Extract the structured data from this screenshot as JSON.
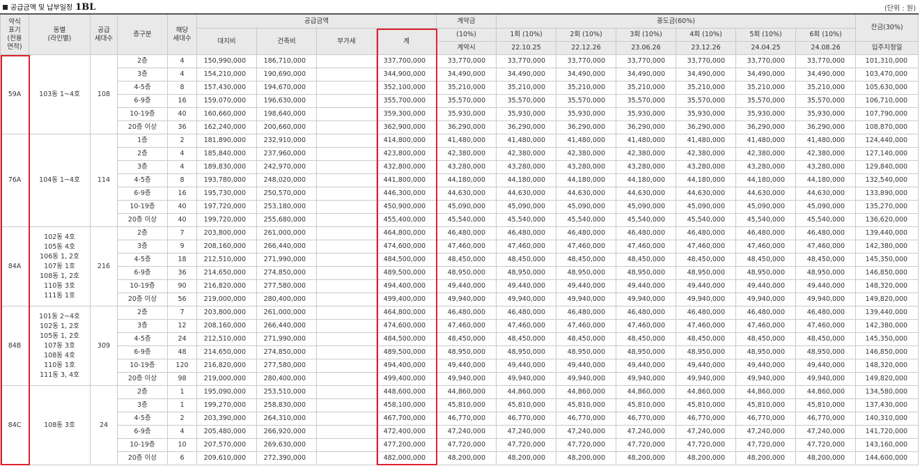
{
  "title": "공급금액 및 납부일정",
  "block": "1BL",
  "unit": "(단위 : 원)",
  "headers": {
    "type": "약식\n표기\n(전용\n면적)",
    "dong": "동별\n(라인별)",
    "supply_units": "공급\n세대수",
    "floor": "층구분",
    "units": "해당\n세대수",
    "supply_price": "공급금액",
    "land": "대지비",
    "building": "건축비",
    "vat": "부가세",
    "total": "계",
    "deposit": "계약금",
    "deposit_pct": "(10%)",
    "deposit_when": "계약시",
    "middle": "중도금(60%)",
    "middle_installments": [
      {
        "label": "1회 (10%)",
        "date": "22.10.25"
      },
      {
        "label": "2회 (10%)",
        "date": "22.12.26"
      },
      {
        "label": "3회 (10%)",
        "date": "23.06.26"
      },
      {
        "label": "4회 (10%)",
        "date": "23.12.26"
      },
      {
        "label": "5회 (10%)",
        "date": "24.04.25"
      },
      {
        "label": "6회 (10%)",
        "date": "24.08.26"
      }
    ],
    "balance": "잔금(30%)",
    "balance_when": "입주지정일"
  },
  "groups": [
    {
      "type": "59A",
      "dong": "103동 1~4호",
      "supply_units": "108",
      "rows": [
        {
          "floor": "2층",
          "units": "4",
          "land": "150,990,000",
          "building": "186,710,000",
          "vat": "",
          "total": "337,700,000",
          "deposit": "33,770,000",
          "middle": "33,770,000",
          "balance": "101,310,000"
        },
        {
          "floor": "3층",
          "units": "4",
          "land": "154,210,000",
          "building": "190,690,000",
          "vat": "",
          "total": "344,900,000",
          "deposit": "34,490,000",
          "middle": "34,490,000",
          "balance": "103,470,000"
        },
        {
          "floor": "4-5층",
          "units": "8",
          "land": "157,430,000",
          "building": "194,670,000",
          "vat": "",
          "total": "352,100,000",
          "deposit": "35,210,000",
          "middle": "35,210,000",
          "balance": "105,630,000"
        },
        {
          "floor": "6-9층",
          "units": "16",
          "land": "159,070,000",
          "building": "196,630,000",
          "vat": "",
          "total": "355,700,000",
          "deposit": "35,570,000",
          "middle": "35,570,000",
          "balance": "106,710,000"
        },
        {
          "floor": "10-19층",
          "units": "40",
          "land": "160,660,000",
          "building": "198,640,000",
          "vat": "",
          "total": "359,300,000",
          "deposit": "35,930,000",
          "middle": "35,930,000",
          "balance": "107,790,000"
        },
        {
          "floor": "20층 이상",
          "units": "36",
          "land": "162,240,000",
          "building": "200,660,000",
          "vat": "",
          "total": "362,900,000",
          "deposit": "36,290,000",
          "middle": "36,290,000",
          "balance": "108,870,000"
        }
      ]
    },
    {
      "type": "76A",
      "dong": "104동 1~4호",
      "supply_units": "114",
      "rows": [
        {
          "floor": "1층",
          "units": "2",
          "land": "181,890,000",
          "building": "232,910,000",
          "vat": "",
          "total": "414,800,000",
          "deposit": "41,480,000",
          "middle": "41,480,000",
          "balance": "124,440,000"
        },
        {
          "floor": "2층",
          "units": "4",
          "land": "185,840,000",
          "building": "237,960,000",
          "vat": "",
          "total": "423,800,000",
          "deposit": "42,380,000",
          "middle": "42,380,000",
          "balance": "127,140,000"
        },
        {
          "floor": "3층",
          "units": "4",
          "land": "189,830,000",
          "building": "242,970,000",
          "vat": "",
          "total": "432,800,000",
          "deposit": "43,280,000",
          "middle": "43,280,000",
          "balance": "129,840,000"
        },
        {
          "floor": "4-5층",
          "units": "8",
          "land": "193,780,000",
          "building": "248,020,000",
          "vat": "",
          "total": "441,800,000",
          "deposit": "44,180,000",
          "middle": "44,180,000",
          "balance": "132,540,000"
        },
        {
          "floor": "6-9층",
          "units": "16",
          "land": "195,730,000",
          "building": "250,570,000",
          "vat": "",
          "total": "446,300,000",
          "deposit": "44,630,000",
          "middle": "44,630,000",
          "balance": "133,890,000"
        },
        {
          "floor": "10-19층",
          "units": "40",
          "land": "197,720,000",
          "building": "253,180,000",
          "vat": "",
          "total": "450,900,000",
          "deposit": "45,090,000",
          "middle": "45,090,000",
          "balance": "135,270,000"
        },
        {
          "floor": "20층 이상",
          "units": "40",
          "land": "199,720,000",
          "building": "255,680,000",
          "vat": "",
          "total": "455,400,000",
          "deposit": "45,540,000",
          "middle": "45,540,000",
          "balance": "136,620,000"
        }
      ]
    },
    {
      "type": "84A",
      "dong": "102동 4호\n105동 4호\n106동 1, 2호\n107동 1호\n108동 1, 2호\n110동 3호\n111동 1호",
      "supply_units": "216",
      "rows": [
        {
          "floor": "2층",
          "units": "7",
          "land": "203,800,000",
          "building": "261,000,000",
          "vat": "",
          "total": "464,800,000",
          "deposit": "46,480,000",
          "middle": "46,480,000",
          "balance": "139,440,000"
        },
        {
          "floor": "3층",
          "units": "9",
          "land": "208,160,000",
          "building": "266,440,000",
          "vat": "",
          "total": "474,600,000",
          "deposit": "47,460,000",
          "middle": "47,460,000",
          "balance": "142,380,000"
        },
        {
          "floor": "4-5층",
          "units": "18",
          "land": "212,510,000",
          "building": "271,990,000",
          "vat": "",
          "total": "484,500,000",
          "deposit": "48,450,000",
          "middle": "48,450,000",
          "balance": "145,350,000"
        },
        {
          "floor": "6-9층",
          "units": "36",
          "land": "214,650,000",
          "building": "274,850,000",
          "vat": "",
          "total": "489,500,000",
          "deposit": "48,950,000",
          "middle": "48,950,000",
          "balance": "146,850,000"
        },
        {
          "floor": "10-19층",
          "units": "90",
          "land": "216,820,000",
          "building": "277,580,000",
          "vat": "",
          "total": "494,400,000",
          "deposit": "49,440,000",
          "middle": "49,440,000",
          "balance": "148,320,000"
        },
        {
          "floor": "20층 이상",
          "units": "56",
          "land": "219,000,000",
          "building": "280,400,000",
          "vat": "",
          "total": "499,400,000",
          "deposit": "49,940,000",
          "middle": "49,940,000",
          "balance": "149,820,000"
        }
      ]
    },
    {
      "type": "84B",
      "dong": "101동 2~4호\n102동 1, 2호\n105동 1, 2호\n107동 3호\n108동 4호\n110동 1호\n111동 3, 4호",
      "supply_units": "309",
      "rows": [
        {
          "floor": "2층",
          "units": "7",
          "land": "203,800,000",
          "building": "261,000,000",
          "vat": "",
          "total": "464,800,000",
          "deposit": "46,480,000",
          "middle": "46,480,000",
          "balance": "139,440,000"
        },
        {
          "floor": "3층",
          "units": "12",
          "land": "208,160,000",
          "building": "266,440,000",
          "vat": "",
          "total": "474,600,000",
          "deposit": "47,460,000",
          "middle": "47,460,000",
          "balance": "142,380,000"
        },
        {
          "floor": "4-5층",
          "units": "24",
          "land": "212,510,000",
          "building": "271,990,000",
          "vat": "",
          "total": "484,500,000",
          "deposit": "48,450,000",
          "middle": "48,450,000",
          "balance": "145,350,000"
        },
        {
          "floor": "6-9층",
          "units": "48",
          "land": "214,650,000",
          "building": "274,850,000",
          "vat": "",
          "total": "489,500,000",
          "deposit": "48,950,000",
          "middle": "48,950,000",
          "balance": "146,850,000"
        },
        {
          "floor": "10-19층",
          "units": "120",
          "land": "216,820,000",
          "building": "277,580,000",
          "vat": "",
          "total": "494,400,000",
          "deposit": "49,440,000",
          "middle": "49,440,000",
          "balance": "148,320,000"
        },
        {
          "floor": "20층 이상",
          "units": "98",
          "land": "219,000,000",
          "building": "280,400,000",
          "vat": "",
          "total": "499,400,000",
          "deposit": "49,940,000",
          "middle": "49,940,000",
          "balance": "149,820,000"
        }
      ]
    },
    {
      "type": "84C",
      "dong": "108동 3호",
      "supply_units": "24",
      "rows": [
        {
          "floor": "2층",
          "units": "1",
          "land": "195,090,000",
          "building": "253,510,000",
          "vat": "",
          "total": "448,600,000",
          "deposit": "44,860,000",
          "middle": "44,860,000",
          "balance": "134,580,000"
        },
        {
          "floor": "3층",
          "units": "1",
          "land": "199,270,000",
          "building": "258,830,000",
          "vat": "",
          "total": "458,100,000",
          "deposit": "45,810,000",
          "middle": "45,810,000",
          "balance": "137,430,000"
        },
        {
          "floor": "4-5층",
          "units": "2",
          "land": "203,390,000",
          "building": "264,310,000",
          "vat": "",
          "total": "467,700,000",
          "deposit": "46,770,000",
          "middle": "46,770,000",
          "balance": "140,310,000"
        },
        {
          "floor": "6-9층",
          "units": "4",
          "land": "205,480,000",
          "building": "266,920,000",
          "vat": "",
          "total": "472,400,000",
          "deposit": "47,240,000",
          "middle": "47,240,000",
          "balance": "141,720,000"
        },
        {
          "floor": "10-19층",
          "units": "10",
          "land": "207,570,000",
          "building": "269,630,000",
          "vat": "",
          "total": "477,200,000",
          "deposit": "47,720,000",
          "middle": "47,720,000",
          "balance": "143,160,000"
        },
        {
          "floor": "20층 이상",
          "units": "6",
          "land": "209,610,000",
          "building": "272,390,000",
          "vat": "",
          "total": "482,000,000",
          "deposit": "48,200,000",
          "middle": "48,200,000",
          "balance": "144,600,000"
        }
      ]
    }
  ]
}
